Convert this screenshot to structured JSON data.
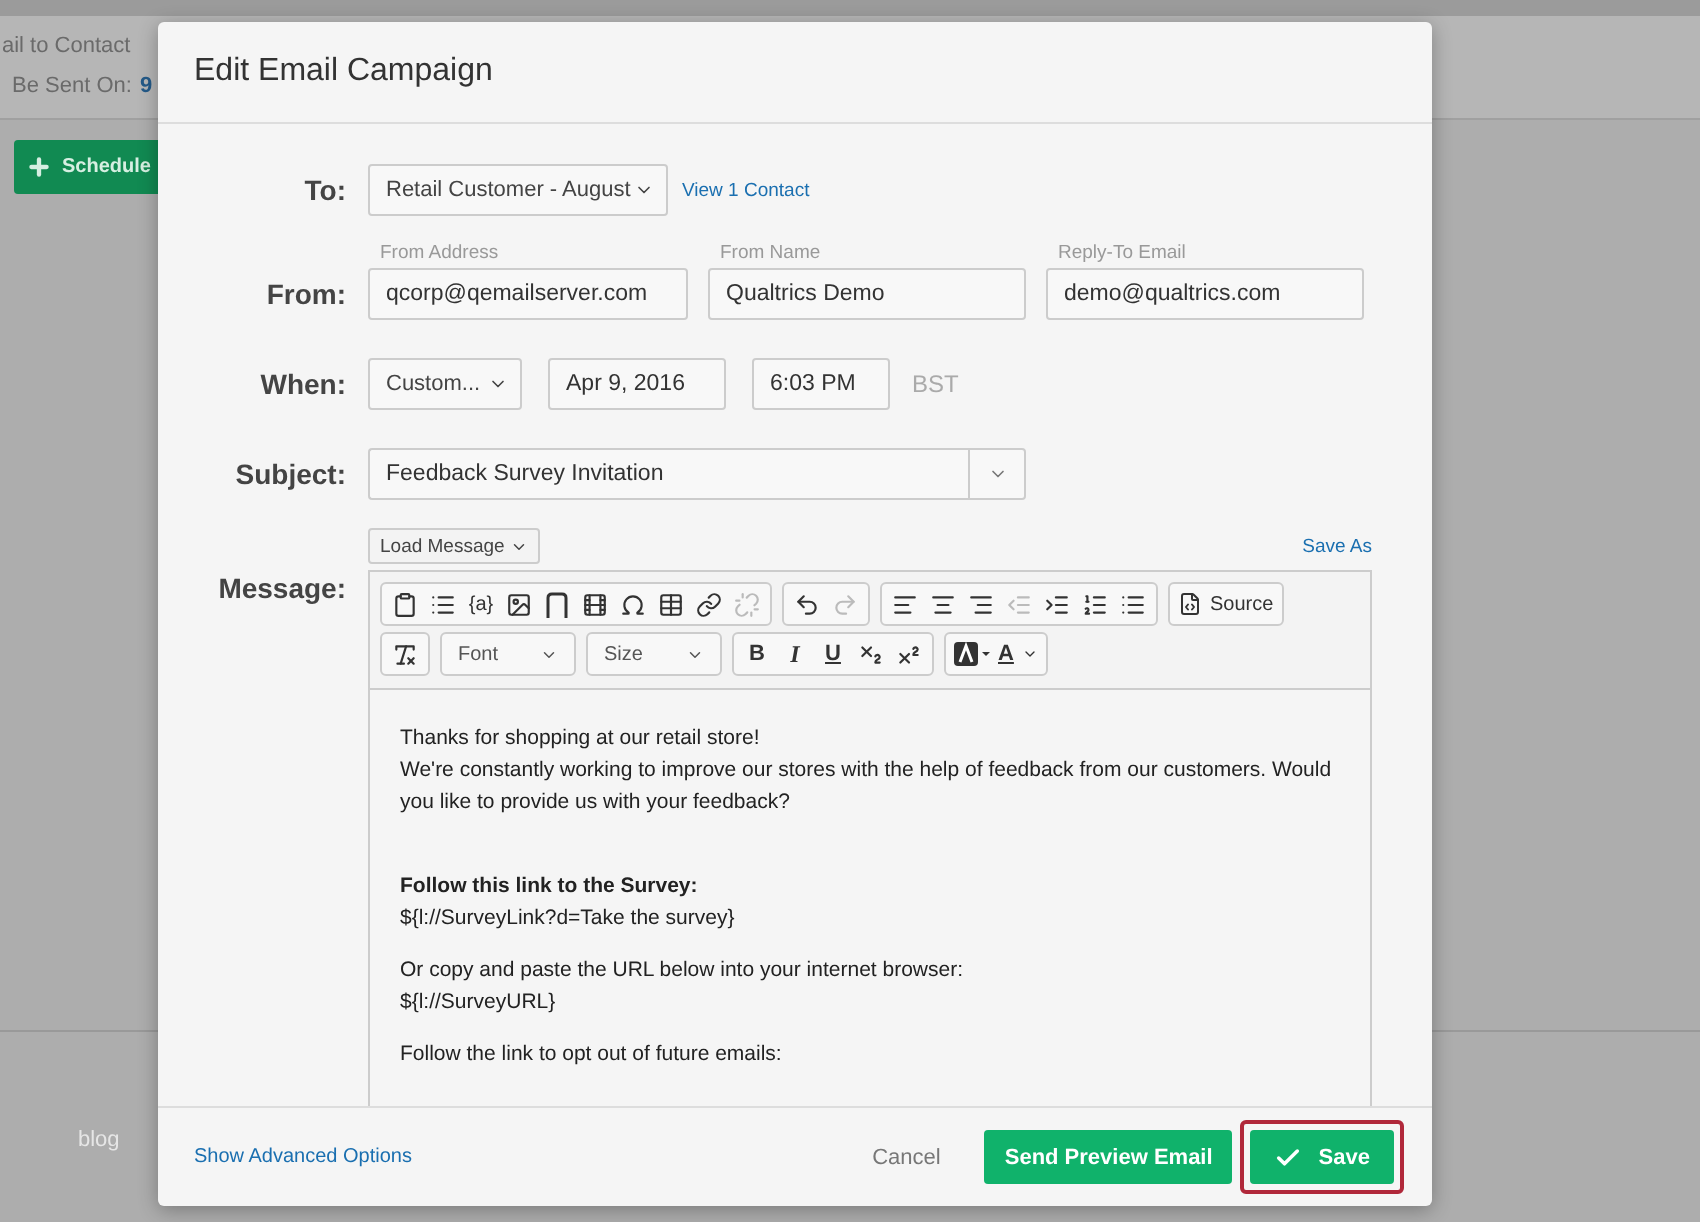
{
  "background": {
    "header_line": "ail to Contact",
    "sent_label": "Be Sent On:",
    "sent_value": "9",
    "schedule_button": "Schedule",
    "footer_link": "blog"
  },
  "dialog": {
    "title": "Edit Email Campaign",
    "to": {
      "label": "To:",
      "value": "Retail Customer - August",
      "link": "View 1 Contact"
    },
    "from": {
      "label": "From:",
      "fields": [
        {
          "caption": "From Address",
          "value": "qcorp@qemailserver.com"
        },
        {
          "caption": "From Name",
          "value": "Qualtrics Demo"
        },
        {
          "caption": "Reply-To Email",
          "value": "demo@qualtrics.com"
        }
      ]
    },
    "when": {
      "label": "When:",
      "mode": "Custom...",
      "date": "Apr 9, 2016",
      "time": "6:03 PM",
      "timezone": "BST"
    },
    "subject": {
      "label": "Subject:",
      "value": "Feedback Survey Invitation"
    },
    "message": {
      "label": "Message:",
      "load_button": "Load Message",
      "save_as": "Save As",
      "toolbar": [
        [
          {
            "group": [
              {
                "kind": "paste",
                "disabled": false
              },
              {
                "kind": "list",
                "disabled": false
              },
              {
                "kind": "text",
                "text": "{a}",
                "disabled": false
              },
              {
                "kind": "image",
                "disabled": false
              },
              {
                "kind": "pagebreak",
                "disabled": false
              },
              {
                "kind": "film",
                "disabled": false
              },
              {
                "kind": "omega",
                "disabled": false
              },
              {
                "kind": "table",
                "disabled": false
              },
              {
                "kind": "link",
                "disabled": false
              },
              {
                "kind": "unlink",
                "disabled": true
              }
            ]
          },
          {
            "group": [
              {
                "kind": "undo",
                "disabled": false
              },
              {
                "kind": "redo",
                "disabled": true
              }
            ]
          },
          {
            "group": [
              {
                "kind": "alignleft",
                "disabled": false
              },
              {
                "kind": "aligncenter",
                "disabled": false
              },
              {
                "kind": "alignright",
                "disabled": false
              },
              {
                "kind": "outdent",
                "disabled": true
              },
              {
                "kind": "indent",
                "disabled": false
              },
              {
                "kind": "numbered",
                "disabled": false
              },
              {
                "kind": "bullets",
                "disabled": false
              }
            ]
          },
          {
            "group": [
              {
                "kind": "source",
                "text": "Source",
                "disabled": false
              }
            ]
          }
        ],
        [
          {
            "group": [
              {
                "kind": "clearformat",
                "disabled": false
              }
            ]
          },
          {
            "group": [
              {
                "kind": "dropdown",
                "text": "Font",
                "disabled": false
              }
            ]
          },
          {
            "group": [
              {
                "kind": "dropdown",
                "text": "Size",
                "disabled": false
              }
            ]
          },
          {
            "group": [
              {
                "kind": "bold",
                "text": "B",
                "disabled": false
              },
              {
                "kind": "italic",
                "text": "I",
                "disabled": false
              },
              {
                "kind": "underline",
                "text": "U",
                "disabled": false
              },
              {
                "kind": "subscript",
                "disabled": false
              },
              {
                "kind": "superscript",
                "disabled": false
              }
            ]
          },
          {
            "group": [
              {
                "kind": "bgcolor",
                "disabled": false
              },
              {
                "kind": "textcolor",
                "text": "A",
                "disabled": false
              }
            ]
          }
        ]
      ],
      "paragraphs": [
        {
          "lines": [
            {
              "text": "Thanks for shopping at our retail store!",
              "bold": false
            },
            {
              "text": "We're constantly working to improve our stores with the help of feedback from our customers. Would you like to provide us with your feedback?",
              "bold": false
            }
          ]
        },
        {
          "lines": [
            {
              "text": "Follow this link to the Survey:",
              "bold": true
            },
            {
              "text": "${l://SurveyLink?d=Take the survey}",
              "bold": false
            }
          ]
        },
        {
          "lines": [
            {
              "text": "Or copy and paste the URL below into your internet browser:",
              "bold": false
            },
            {
              "text": "${l://SurveyURL}",
              "bold": false
            }
          ]
        },
        {
          "lines": [
            {
              "text": "Follow the link to opt out of future emails:",
              "bold": false
            }
          ]
        }
      ]
    },
    "footer": {
      "advanced_link": "Show Advanced Options",
      "cancel": "Cancel",
      "preview": "Send Preview Email",
      "save": {
        "label": "Save",
        "highlighted": true
      }
    }
  }
}
